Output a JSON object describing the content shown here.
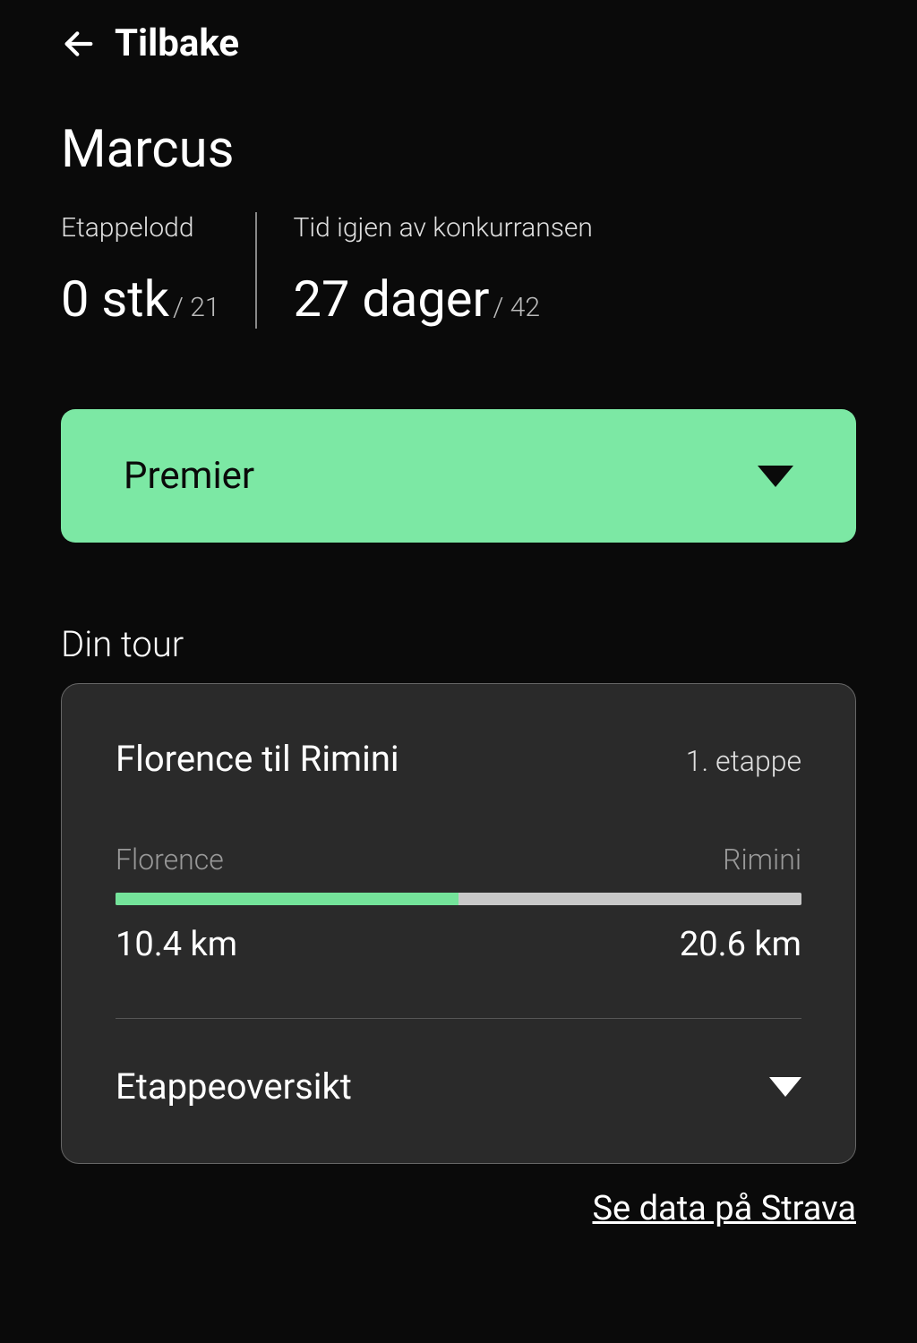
{
  "back": {
    "label": "Tilbake"
  },
  "user": {
    "name": "Marcus"
  },
  "stats": {
    "left": {
      "label": "Etappelodd",
      "value": "0 stk",
      "sub": "/ 21"
    },
    "right": {
      "label": "Tid igjen av konkurransen",
      "value": "27 dager",
      "sub": "/ 42"
    }
  },
  "premier": {
    "label": "Premier"
  },
  "tour": {
    "section_title": "Din tour",
    "stage_name": "Florence til Rimini",
    "stage_num": "1. etappe",
    "city_from": "Florence",
    "city_to": "Rimini",
    "progress_percent": 50,
    "distance_done": "10.4 km",
    "distance_total": "20.6 km",
    "overview_label": "Etappeoversikt"
  },
  "strava": {
    "label": "Se data på Strava"
  }
}
